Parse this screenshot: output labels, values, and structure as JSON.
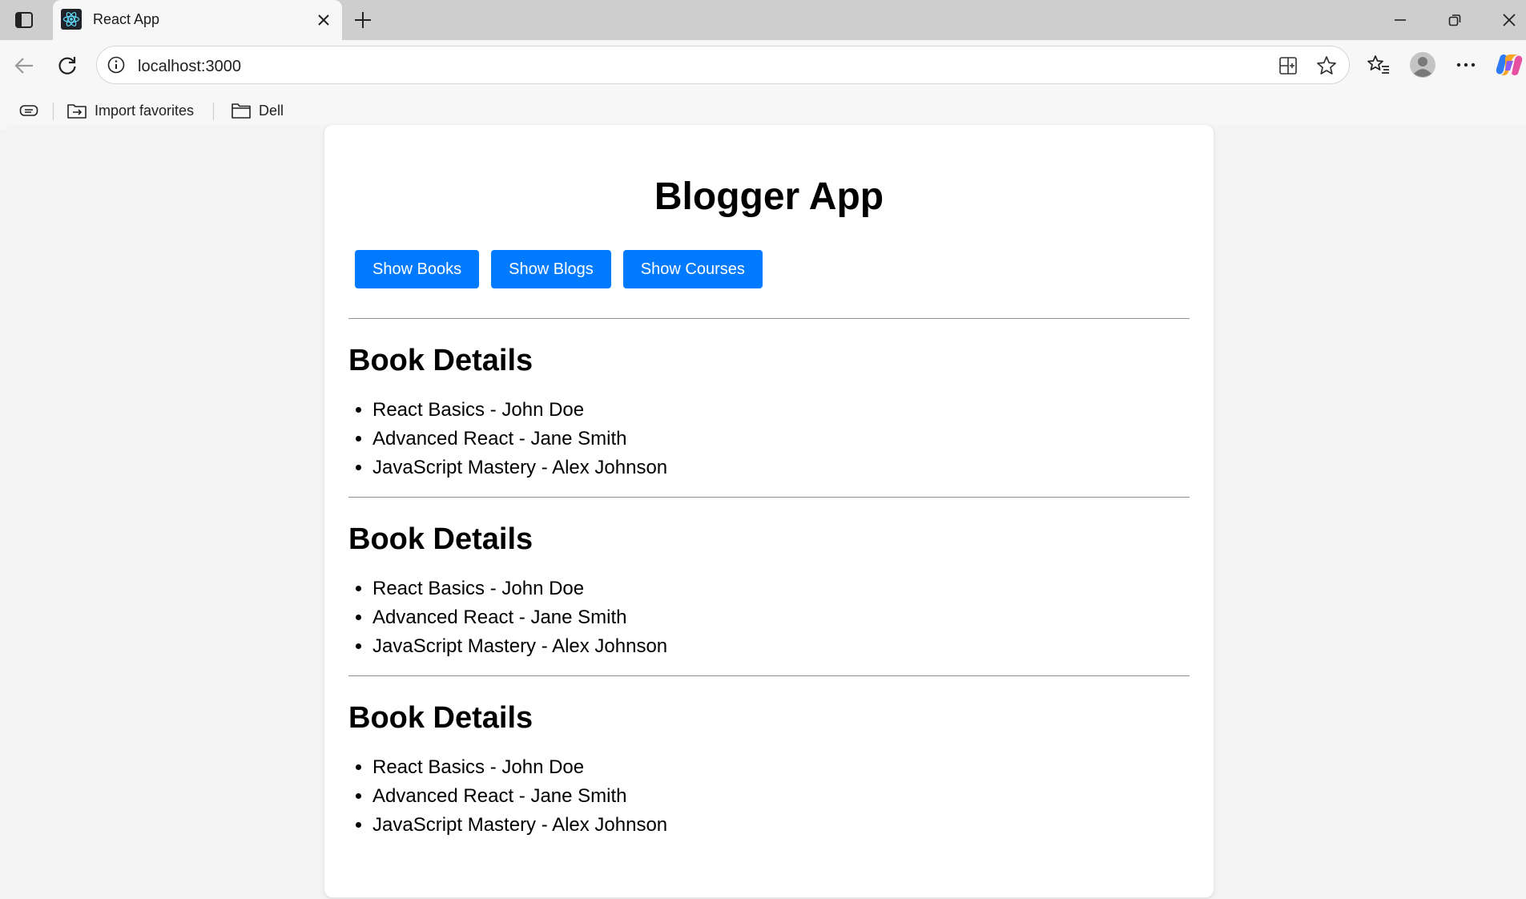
{
  "browser": {
    "tab_title": "React App",
    "address": "localhost:3000",
    "bookmarks": [
      {
        "label": "Import favorites",
        "icon": "import-favorites-icon"
      },
      {
        "label": "Dell",
        "icon": "folder-icon"
      }
    ]
  },
  "app": {
    "title": "Blogger App",
    "buttons": [
      "Show Books",
      "Show Blogs",
      "Show Courses"
    ],
    "button_color": "#007bff",
    "sections": [
      {
        "heading": "Book Details",
        "items": [
          "React Basics - John Doe",
          "Advanced React - Jane Smith",
          "JavaScript Mastery - Alex Johnson"
        ]
      },
      {
        "heading": "Book Details",
        "items": [
          "React Basics - John Doe",
          "Advanced React - Jane Smith",
          "JavaScript Mastery - Alex Johnson"
        ]
      },
      {
        "heading": "Book Details",
        "items": [
          "React Basics - John Doe",
          "Advanced React - Jane Smith",
          "JavaScript Mastery - Alex Johnson"
        ]
      }
    ]
  }
}
